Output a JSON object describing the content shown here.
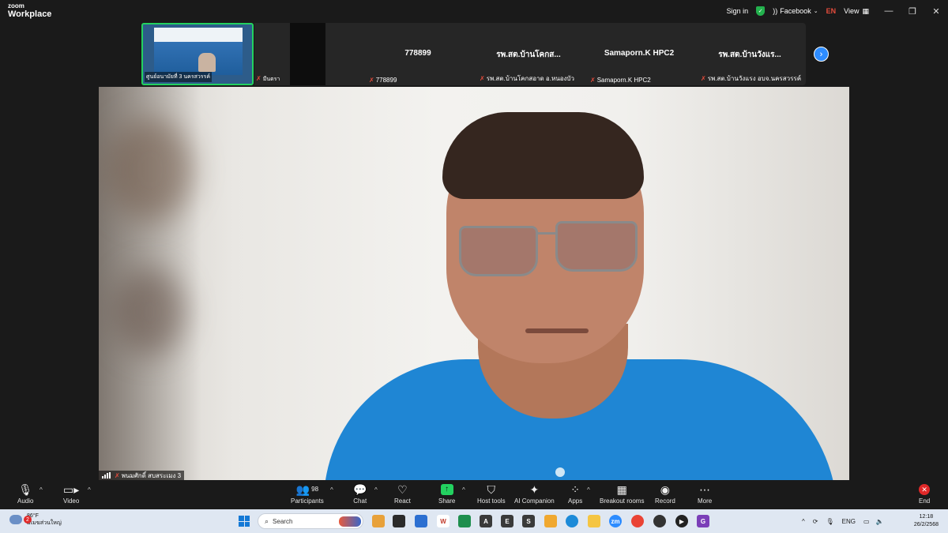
{
  "app": {
    "brand_top": "zoom",
    "brand_bottom": "Workplace"
  },
  "titlebar": {
    "sign_in": "Sign in",
    "shield_icon": "shield-check-icon",
    "feed_label": "Facebook",
    "language": "EN",
    "view_label": "View",
    "colors": {
      "shield": "#23b14d",
      "language": "#e74c3c"
    }
  },
  "thumbnails": {
    "active": {
      "caption": "ศูนย์อนามัยที่ 3 นครสวรรค์"
    },
    "second": {
      "caption": "มีนตรา"
    },
    "tiles": [
      {
        "name": "778899",
        "caption": "778899"
      },
      {
        "name": "รพ.สต.บ้านโคกส...",
        "caption": "รพ.สต.บ้านโคกสอาด อ.หนองบัว"
      },
      {
        "name": "Samaporn.K HPC2",
        "caption": "Samaporn.K HPC2"
      },
      {
        "name": "รพ.สต.บ้านวังแร...",
        "caption": "รพ.สต.บ้านวังแรง อบจ.นครสวรรค์"
      }
    ]
  },
  "main_video": {
    "caption": "พนมศักดิ์ สบสระเมง 3"
  },
  "toolbar": {
    "audio": "Audio",
    "video": "Video",
    "participants": "Participants",
    "participants_count": "98",
    "chat": "Chat",
    "react": "React",
    "share": "Share",
    "host_tools": "Host tools",
    "ai_companion": "AI Companion",
    "apps": "Apps",
    "breakout_rooms": "Breakout rooms",
    "record": "Record",
    "more": "More",
    "end": "End",
    "colors": {
      "share": "#23d160",
      "end": "#e02828"
    }
  },
  "taskbar": {
    "weather_badge": "2",
    "temperature": "86°F",
    "weather_desc": "มีเมฆส่วนใหญ่",
    "search_placeholder": "Search",
    "tray_language": "ENG",
    "time": "12:18",
    "date": "26/2/2568"
  }
}
